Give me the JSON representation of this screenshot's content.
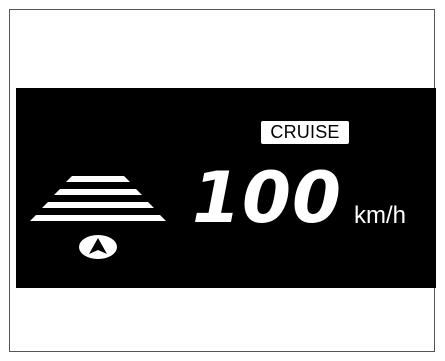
{
  "display": {
    "cruise_label": "CRUISE",
    "speed_value": "100",
    "speed_unit": "km/h",
    "lane_indicator_icon": "following-distance-bars-icon",
    "vehicle_icon": "vehicle-ahead-arrow-icon",
    "colors": {
      "background": "#000000",
      "foreground": "#ffffff",
      "page": "#ffffff",
      "frame_border": "#555555"
    }
  }
}
